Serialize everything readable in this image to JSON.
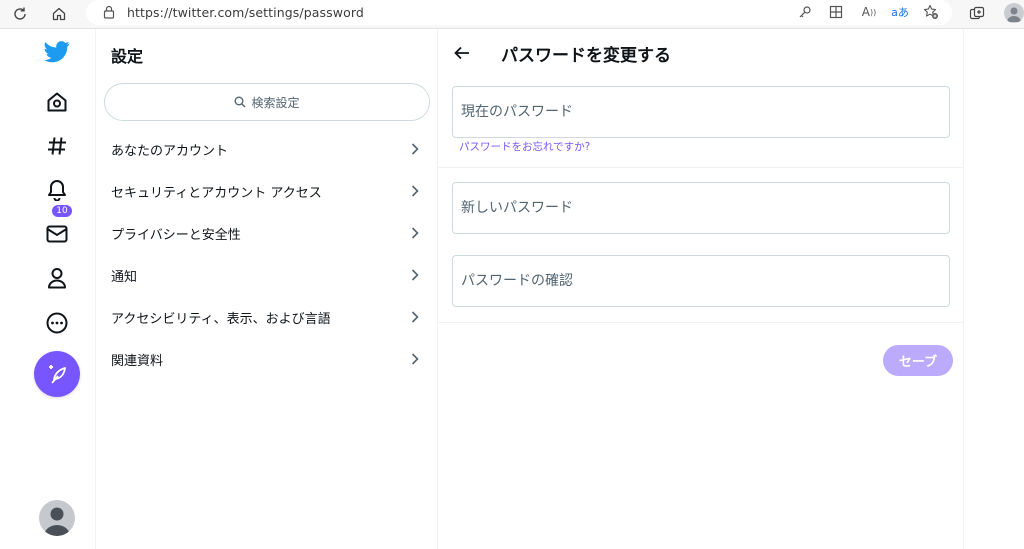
{
  "browser": {
    "url": "https://twitter.com/settings/password",
    "translate_icon_text": "aあ"
  },
  "nav": {
    "notification_badge": "10",
    "accent_color": "#7856ff",
    "brand_color": "#1d9bf0"
  },
  "settings": {
    "title": "設定",
    "search_placeholder": "検索設定",
    "items": [
      {
        "label": "あなたのアカウント"
      },
      {
        "label": "セキュリティとアカウント アクセス"
      },
      {
        "label": "プライバシーと安全性"
      },
      {
        "label": "通知"
      },
      {
        "label": "アクセシビリティ、表示、および言語"
      },
      {
        "label": "関連資料"
      }
    ]
  },
  "password": {
    "title": "パスワードを変更する",
    "current_placeholder": "現在のパスワード",
    "forgot_link": "パスワードをお忘れですか?",
    "new_placeholder": "新しいパスワード",
    "confirm_placeholder": "パスワードの確認",
    "save_label": "セーブ"
  }
}
